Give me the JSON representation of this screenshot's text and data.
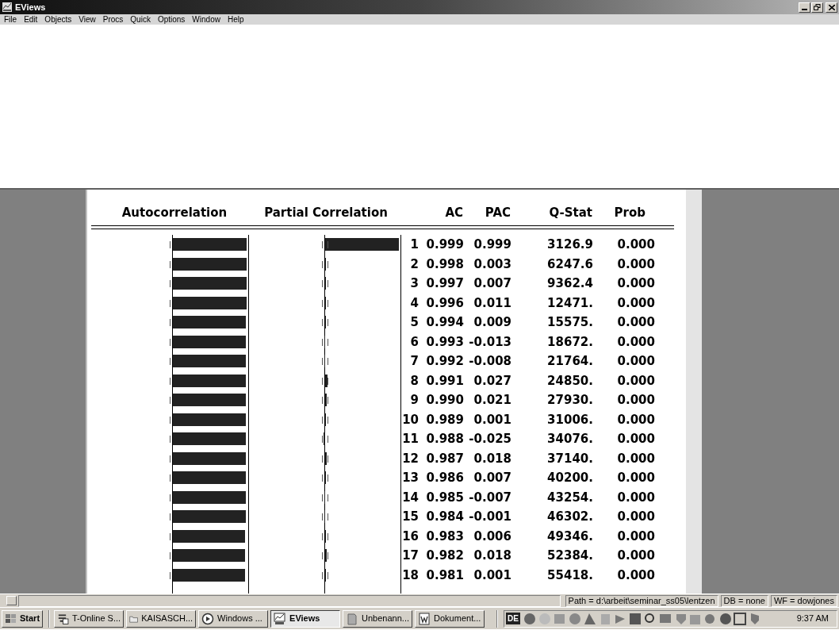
{
  "window": {
    "title": "EViews"
  },
  "menu": [
    "File",
    "Edit",
    "Objects",
    "View",
    "Procs",
    "Quick",
    "Options",
    "Window",
    "Help"
  ],
  "correlogram": {
    "headers": [
      "Autocorrelation",
      "Partial Correlation",
      "AC",
      "PAC",
      "Q-Stat",
      "Prob"
    ],
    "rows": [
      {
        "lag": "1",
        "ac": "0.999",
        "pac": "0.999",
        "q_stat": "3126.9",
        "prob": "0.000"
      },
      {
        "lag": "2",
        "ac": "0.998",
        "pac": "0.003",
        "q_stat": "6247.6",
        "prob": "0.000"
      },
      {
        "lag": "3",
        "ac": "0.997",
        "pac": "0.007",
        "q_stat": "9362.4",
        "prob": "0.000"
      },
      {
        "lag": "4",
        "ac": "0.996",
        "pac": "0.011",
        "q_stat": "12471.",
        "prob": "0.000"
      },
      {
        "lag": "5",
        "ac": "0.994",
        "pac": "0.009",
        "q_stat": "15575.",
        "prob": "0.000"
      },
      {
        "lag": "6",
        "ac": "0.993",
        "pac": "-0.013",
        "q_stat": "18672.",
        "prob": "0.000"
      },
      {
        "lag": "7",
        "ac": "0.992",
        "pac": "-0.008",
        "q_stat": "21764.",
        "prob": "0.000"
      },
      {
        "lag": "8",
        "ac": "0.991",
        "pac": "0.027",
        "q_stat": "24850.",
        "prob": "0.000"
      },
      {
        "lag": "9",
        "ac": "0.990",
        "pac": "0.021",
        "q_stat": "27930.",
        "prob": "0.000"
      },
      {
        "lag": "10",
        "ac": "0.989",
        "pac": "0.001",
        "q_stat": "31006.",
        "prob": "0.000"
      },
      {
        "lag": "11",
        "ac": "0.988",
        "pac": "-0.025",
        "q_stat": "34076.",
        "prob": "0.000"
      },
      {
        "lag": "12",
        "ac": "0.987",
        "pac": "0.018",
        "q_stat": "37140.",
        "prob": "0.000"
      },
      {
        "lag": "13",
        "ac": "0.986",
        "pac": "0.007",
        "q_stat": "40200.",
        "prob": "0.000"
      },
      {
        "lag": "14",
        "ac": "0.985",
        "pac": "-0.007",
        "q_stat": "43254.",
        "prob": "0.000"
      },
      {
        "lag": "15",
        "ac": "0.984",
        "pac": "-0.001",
        "q_stat": "46302.",
        "prob": "0.000"
      },
      {
        "lag": "16",
        "ac": "0.983",
        "pac": "0.006",
        "q_stat": "49346.",
        "prob": "0.000"
      },
      {
        "lag": "17",
        "ac": "0.982",
        "pac": "0.018",
        "q_stat": "52384.",
        "prob": "0.000"
      },
      {
        "lag": "18",
        "ac": "0.981",
        "pac": "0.001",
        "q_stat": "55418.",
        "prob": "0.000"
      }
    ]
  },
  "status_bar": {
    "fields": [
      "Path = d:\\arbeit\\seminar_ss05\\lentzen",
      "DB = none",
      "WF = dowjones"
    ]
  },
  "taskbar": {
    "start": "Start",
    "buttons": [
      {
        "label": "T-Online S...",
        "kind": "network",
        "selected": false
      },
      {
        "label": "KAISASCH...",
        "kind": "folder",
        "selected": false
      },
      {
        "label": "Windows ...",
        "kind": "media",
        "selected": false
      },
      {
        "label": "EViews",
        "kind": "chart",
        "selected": true
      },
      {
        "label": "Unbenann...",
        "kind": "notepad",
        "selected": false
      },
      {
        "label": "Dokument...",
        "kind": "document",
        "selected": false
      }
    ],
    "tray_badge": "DE",
    "clock": "9:37 AM"
  }
}
